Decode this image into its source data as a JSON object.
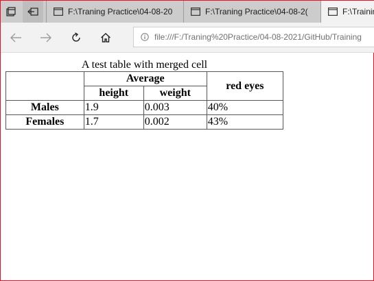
{
  "browser": {
    "tabs": [
      {
        "title": "F:\\Traning Practice\\04-08-20",
        "current": false
      },
      {
        "title": "F:\\Traning Practice\\04-08-2(",
        "current": false
      },
      {
        "title": "F:\\Trainin",
        "current": true
      }
    ],
    "address_url": "file:///F:/Traning%20Practice/04-08-2021/GitHub/Training"
  },
  "table": {
    "caption": "A test table with merged cell",
    "group_header": "Average",
    "sub_headers": [
      "height",
      "weight"
    ],
    "last_header": "red eyes",
    "rows": [
      {
        "label": "Males",
        "height": "1.9",
        "weight": "0.003",
        "red_eyes": "40%"
      },
      {
        "label": "Females",
        "height": "1.7",
        "weight": "0.002",
        "red_eyes": "43%"
      }
    ]
  }
}
